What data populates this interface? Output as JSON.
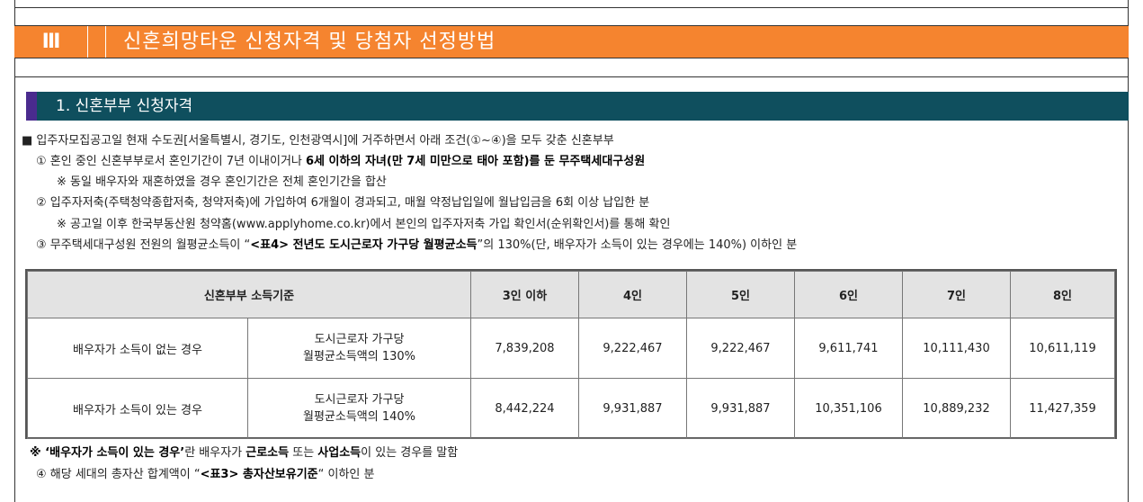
{
  "section": {
    "roman": "Ⅲ",
    "title": "신혼희망타운 신청자격 및 당첨자 선정방법"
  },
  "subsection": {
    "title": "1. 신혼부부 신청자격"
  },
  "lines": {
    "intro": "■ 입주자모집공고일 현재 수도권[서울특별시, 경기도, 인천광역시]에 거주하면서 아래 조건(①~④)을 모두 갖춘 신혼부부",
    "c1_plain": "① 혼인 중인 신혼부부로서 혼인기간이 7년 이내이거나 ",
    "c1_bold": "6세 이하의 자녀(만 7세 미만으로 태아 포함)를 둔 무주택세대구성원",
    "c1_note": "※ 동일 배우자와 재혼하였을 경우 혼인기간은 전체 혼인기간을 합산",
    "c2": "② 입주자저축(주택청약종합저축, 청약저축)에 가입하여 6개월이 경과되고, 매월 약정납입일에 월납입금을 6회 이상 납입한 분",
    "c2_note": "※ 공고일 이후 한국부동산원 청약홈(www.applyhome.co.kr)에서 본인의 입주자저축 가입 확인서(순위확인서)를 통해 확인",
    "c3_a": "③ 무주택세대구성원 전원의 월평균소득이 “",
    "c3_bold": "<표4> 전년도 도시근로자 가구당 월평균소득",
    "c3_b": "”의 130%(단, 배우자가 소득이 있는 경우에는 140%) 이하인 분",
    "note_star": "※ ",
    "note_bold1": "‘배우자가 소득이 있는 경우’",
    "note_a": "란 배우자가 ",
    "note_bold2": "근로소득",
    "note_b": " 또는 ",
    "note_bold3": "사업소득",
    "note_c": "이 있는 경우를 말함",
    "c4_a": "④ 해당 세대의 총자산 합계액이 “",
    "c4_bold": "<표3> 총자산보유기준",
    "c4_b": "“ 이하인 분"
  },
  "table": {
    "header": [
      "신혼부부 소득기준",
      "3인 이하",
      "4인",
      "5인",
      "6인",
      "7인",
      "8인"
    ],
    "rows": [
      {
        "label": "배우자가 소득이 없는 경우",
        "basis_1": "도시근로자 가구당",
        "basis_2": "월평균소득액의 130%",
        "values": [
          "7,839,208",
          "9,222,467",
          "9,222,467",
          "9,611,741",
          "10,111,430",
          "10,611,119"
        ]
      },
      {
        "label": "배우자가 소득이 있는 경우",
        "basis_1": "도시근로자 가구당",
        "basis_2": "월평균소득액의 140%",
        "values": [
          "8,442,224",
          "9,931,887",
          "9,931,887",
          "10,351,106",
          "10,889,232",
          "11,427,359"
        ]
      }
    ]
  },
  "colors": {
    "section_bar": "#f5842f",
    "subsection_bar": "#0f4f5e",
    "subsection_accent": "#4a2b8e",
    "table_header": "#e3e3e3"
  }
}
